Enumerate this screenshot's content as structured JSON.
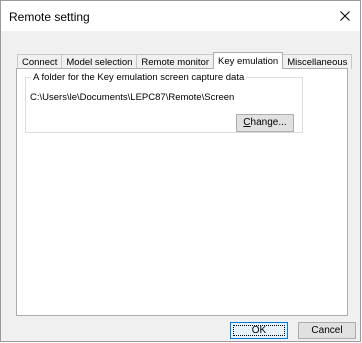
{
  "window": {
    "title": "Remote setting",
    "close_glyph": "×",
    "close_icon": "close-icon"
  },
  "tabs": [
    {
      "label": "Connect",
      "active": false
    },
    {
      "label": "Model selection",
      "active": false
    },
    {
      "label": "Remote monitor",
      "active": false
    },
    {
      "label": "Key emulation",
      "active": true
    },
    {
      "label": "Miscellaneous",
      "active": false
    }
  ],
  "key_emulation": {
    "group_label": "A folder for the Key emulation screen capture data",
    "folder_path": "C:\\Users\\le\\Documents\\LEPC87\\Remote\\Screen",
    "change_button": {
      "mnemonic": "C",
      "rest": "hange..."
    }
  },
  "footer": {
    "ok_label": "OK",
    "cancel_label": "Cancel"
  }
}
